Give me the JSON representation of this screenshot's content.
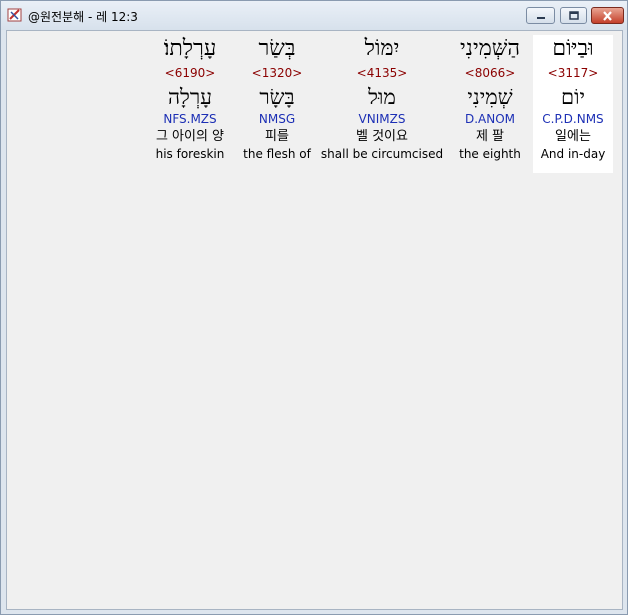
{
  "window": {
    "title": "@원전분해 - 레 12:3",
    "app_icon": "bible-app-icon",
    "controls": {
      "minimize_icon": "minimize-icon",
      "maximize_icon": "maximize-icon",
      "close_icon": "close-icon"
    }
  },
  "words": [
    {
      "hebrew": "וּבַיּוֹם",
      "strong": "<3117>",
      "lemma": "יוֹם",
      "morph": "C.P.D.NMS",
      "korean": "일에는",
      "english": "And in-day",
      "selected": true
    },
    {
      "hebrew": "הַשְּׁמִינִי",
      "strong": "<8066>",
      "lemma": "שְׁמִינִי",
      "morph": "D.ANOM",
      "korean": "제 팔",
      "english": "the eighth",
      "selected": false
    },
    {
      "hebrew": "יִמּוֹל",
      "strong": "<4135>",
      "lemma": "מוּל",
      "morph": "VNIMZS",
      "korean": "벨 것이요",
      "english": "shall be circumcised",
      "selected": false
    },
    {
      "hebrew": "בְּשַׂר",
      "strong": "<1320>",
      "lemma": "בָּשָׂר",
      "morph": "NMSG",
      "korean": "피를",
      "english": "the flesh of",
      "selected": false
    },
    {
      "hebrew": "עָרְלָתוֹ׃",
      "strong": "<6190>",
      "lemma": "עָרְלָה",
      "morph": "NFS.MZS",
      "korean": "그 아이의 양",
      "english": "his foreskin",
      "selected": false
    }
  ]
}
